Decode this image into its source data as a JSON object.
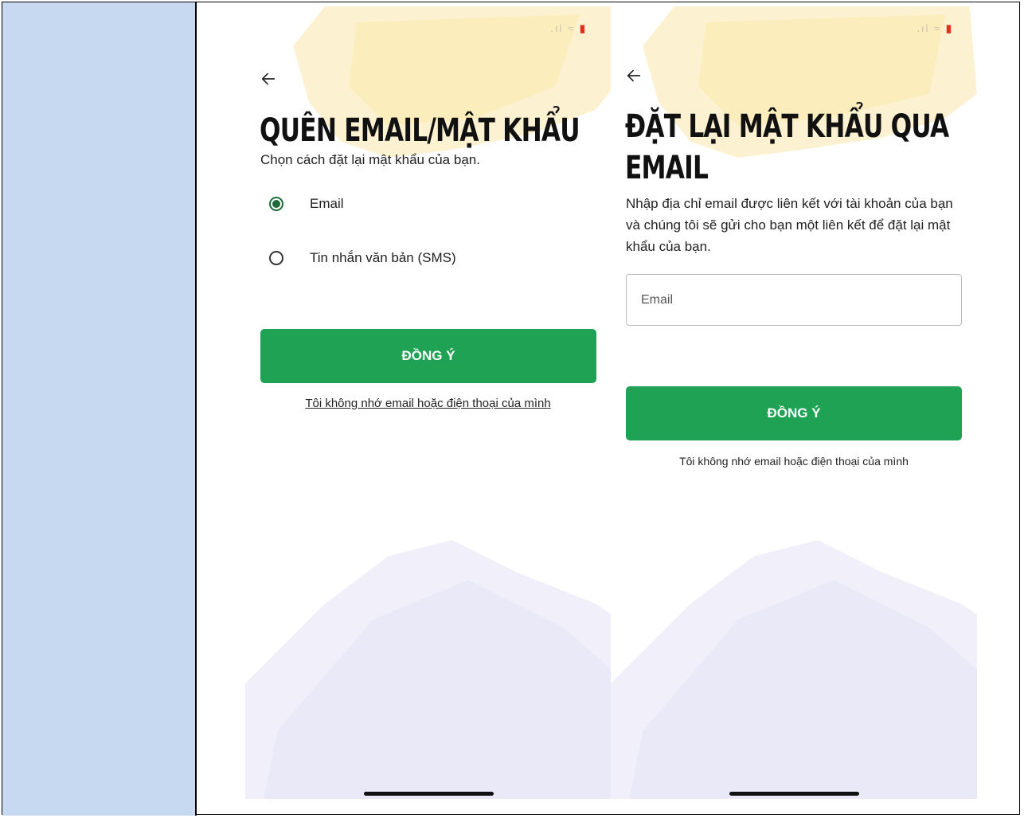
{
  "colors": {
    "accent": "#1fa254",
    "radio_selected": "#1e6b3c",
    "side_cell": "#c6d9f0"
  },
  "screen1": {
    "title": "QUÊN EMAIL/MẬT KHẨU",
    "subtitle": "Chọn cách đặt lại mật khẩu của bạn.",
    "options": [
      {
        "label": "Email",
        "selected": true
      },
      {
        "label": "Tin nhắn văn bản (SMS)",
        "selected": false
      }
    ],
    "confirm_label": "ĐỒNG Ý",
    "forgot_link": "Tôi không nhớ email hoặc điện thoại của mình"
  },
  "screen2": {
    "title_line1": "ĐẶT LẠI MẬT KHẨU QUA",
    "title_line2": "EMAIL",
    "description": "Nhập địa chỉ email được liên kết với tài khoản của bạn và chúng tôi sẽ gửi cho bạn một liên kết để đặt lại mật khẩu của bạn.",
    "email_placeholder": "Email",
    "confirm_label": "ĐỒNG Ý",
    "forgot_link": "Tôi không nhớ email hoặc điện thoại của mình"
  },
  "icons": {
    "back": "arrow-left-icon",
    "signal": "signal-icon",
    "wifi": "wifi-icon",
    "battery": "battery-icon"
  }
}
